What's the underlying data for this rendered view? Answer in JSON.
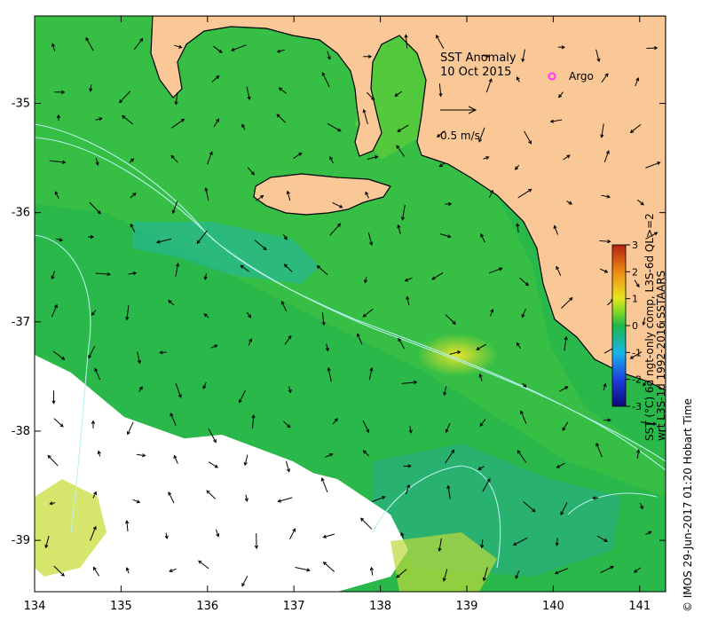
{
  "map": {
    "title": "SST Anomaly",
    "date": "10 Oct 2015",
    "x_ticks": [
      "134",
      "135",
      "136",
      "137",
      "138",
      "139",
      "140",
      "141"
    ],
    "y_ticks": [
      "-35",
      "-36",
      "-37",
      "-38",
      "-39"
    ],
    "x_range": [
      134.0,
      141.3
    ],
    "y_range": [
      -39.47,
      -34.2
    ],
    "colors": {
      "land": "#f9c896",
      "sea_base": "#2bb84a",
      "cloud_mask": "#ffffff",
      "contour": "#b8f0f0",
      "argo_marker": "#ff33ff"
    }
  },
  "legend": {
    "argo_label": "Argo",
    "scale_value": "0.5 m/s"
  },
  "colorbar": {
    "ticks": [
      "3",
      "2",
      "1",
      "0",
      "-1",
      "-2",
      "-3"
    ],
    "range": [
      -3,
      3
    ],
    "caption_lines": [
      "SST (°C) 6d ngt-only comp, L3S-6d QL>=2",
      "wrt L3S-1d 1992-2016 SSTAARS"
    ]
  },
  "credit": "© IMOS 29-Jun-2017 01:20 Hobart Time"
}
